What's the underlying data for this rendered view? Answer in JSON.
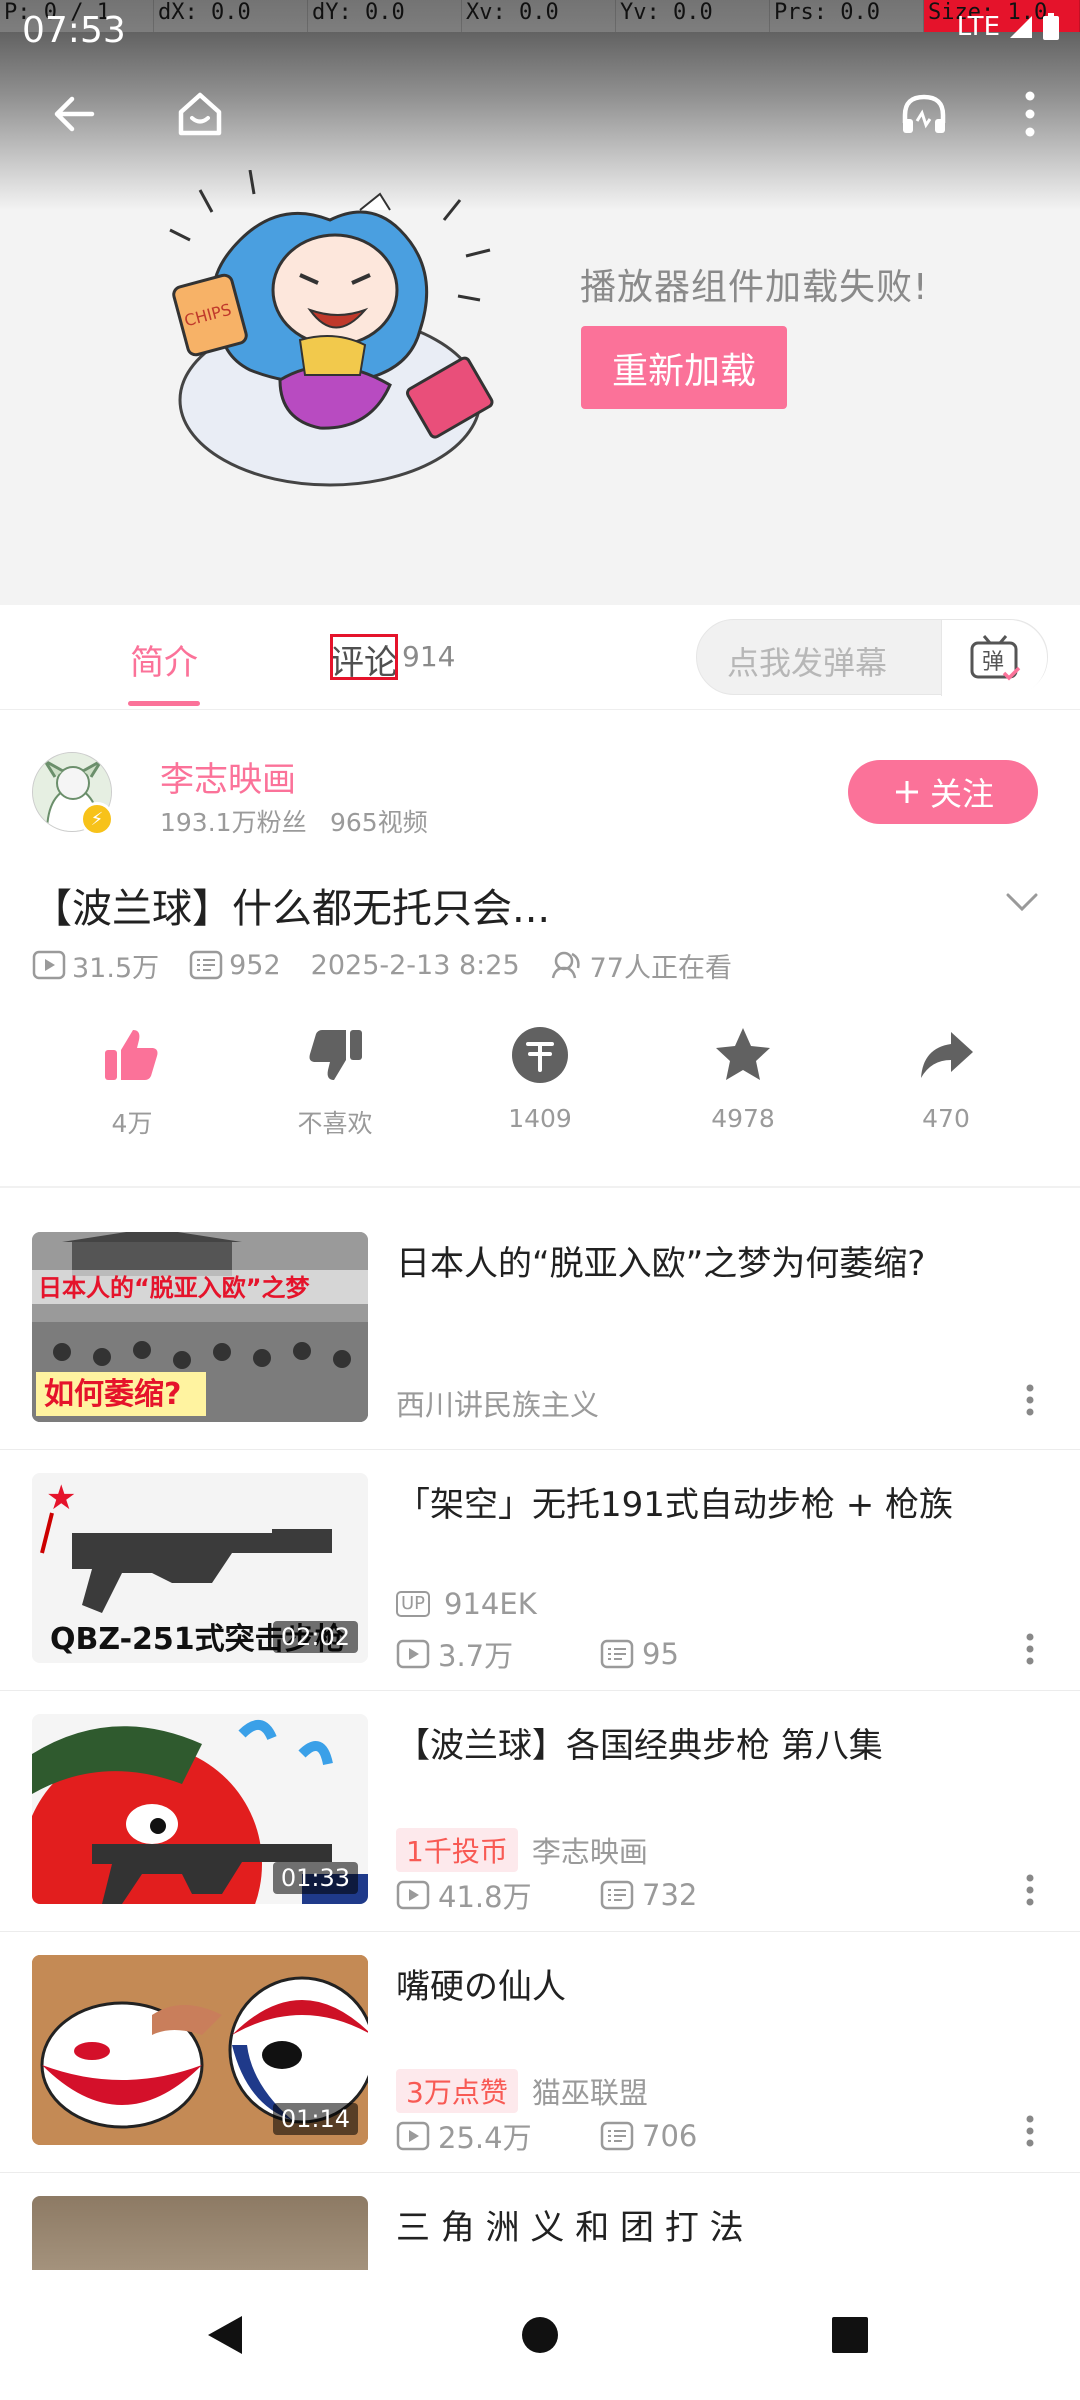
{
  "debug_overlay": {
    "pointer": "P: 0 / 1",
    "dx": "dX: 0.0",
    "dy": "dY: 0.0",
    "xv": "Xv: 0.0",
    "yv": "Yv: 0.0",
    "prs": "Prs: 0.0",
    "size": "Size: 1.0"
  },
  "status_bar": {
    "time": "07:53",
    "network": "LTE"
  },
  "player": {
    "error_message": "播放器组件加载失败!",
    "reload_label": "重新加载"
  },
  "tabs": {
    "intro": "简介",
    "comments": "评论",
    "comment_count": "914",
    "danmaku_placeholder": "点我发弹幕",
    "danmaku_icon_text": "弹"
  },
  "uploader": {
    "name": "李志映画",
    "fans": "193.1万粉丝",
    "videos": "965视频",
    "follow_label": "关注"
  },
  "video": {
    "title": "【波兰球】什么都无托只会...",
    "views": "31.5万",
    "danmaku": "952",
    "date": "2025-2-13 8:25",
    "watching": "77人正在看"
  },
  "actions": {
    "like": "4万",
    "dislike": "不喜欢",
    "coin": "1409",
    "favorite": "4978",
    "share": "470"
  },
  "related": [
    {
      "title": "日本人的“脱亚入欧”之梦为何萎缩?",
      "author": "西川讲民族主义",
      "thumb_caption_top": "日本人的“脱亚入欧”之梦",
      "thumb_caption_bottom": "如何萎缩?"
    },
    {
      "title": "「架空」无托191式自动步枪 + 枪族",
      "up_badge": "UP",
      "author": "914EK",
      "views": "3.7万",
      "danmaku": "95",
      "duration": "02:02",
      "thumb_caption": "QBZ-251式突击步枪"
    },
    {
      "title": "【波兰球】各国经典步枪 第八集",
      "tag": "1千投币",
      "author": "李志映画",
      "views": "41.8万",
      "danmaku": "732",
      "duration": "01:33"
    },
    {
      "title": "嘴硬の仙人",
      "tag": "3万点赞",
      "author": "猫巫联盟",
      "views": "25.4万",
      "danmaku": "706",
      "duration": "01:14"
    },
    {
      "title": "三 角 洲 义 和 团 打 法"
    }
  ],
  "colors": {
    "accent": "#fb7299",
    "tag_text": "#f85a54",
    "highlight": "#e5132b"
  }
}
